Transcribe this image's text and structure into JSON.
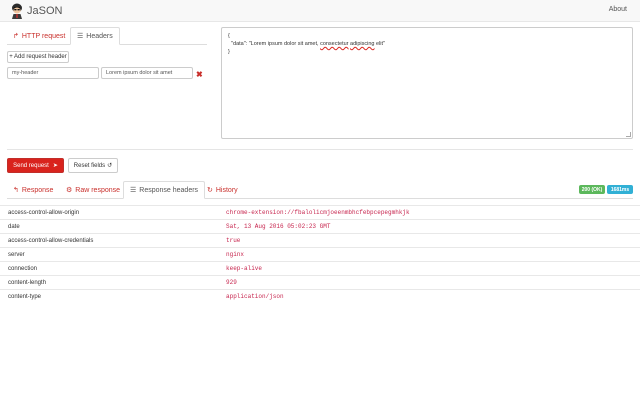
{
  "app": {
    "title": "JaSON",
    "about": "About"
  },
  "request_tabs": [
    {
      "label": "HTTP request",
      "icon": "share-icon"
    },
    {
      "label": "Headers",
      "icon": "list-icon"
    }
  ],
  "headers_panel": {
    "add_button": "+ Add request header",
    "rows": [
      {
        "name": "my-header",
        "value": "Lorem ipsum dolor sit amet"
      }
    ]
  },
  "body_editor": {
    "line1": "{",
    "line2_key": "  \"data\": \"Lorem ipsum dolor sit amet, ",
    "line2_spell1": "consectetur",
    "line2_mid": " ",
    "line2_spell2": "adipiscing",
    "line2_end": " elit\"",
    "line3": "}"
  },
  "actions": {
    "send": "Send request",
    "reset": "Reset fields"
  },
  "response_tabs": [
    {
      "label": "Response",
      "icon": "reply-icon"
    },
    {
      "label": "Raw response",
      "icon": "cogs-icon"
    },
    {
      "label": "Response headers",
      "icon": "list-icon"
    },
    {
      "label": "History",
      "icon": "history-icon"
    }
  ],
  "status": {
    "code": "200 (OK)",
    "time": "1681ms",
    "code_color": "#5cb85c",
    "time_color": "#31b0d5"
  },
  "response_headers": [
    {
      "key": "access-control-allow-origin",
      "value": "chrome-extension://fbalolicmjoeenmbhcfebpcepegmhkjk"
    },
    {
      "key": "date",
      "value": "Sat, 13 Aug 2016 05:02:23 GMT"
    },
    {
      "key": "access-control-allow-credentials",
      "value": "true"
    },
    {
      "key": "server",
      "value": "nginx"
    },
    {
      "key": "connection",
      "value": "keep-alive"
    },
    {
      "key": "content-length",
      "value": "929"
    },
    {
      "key": "content-type",
      "value": "application/json"
    }
  ]
}
